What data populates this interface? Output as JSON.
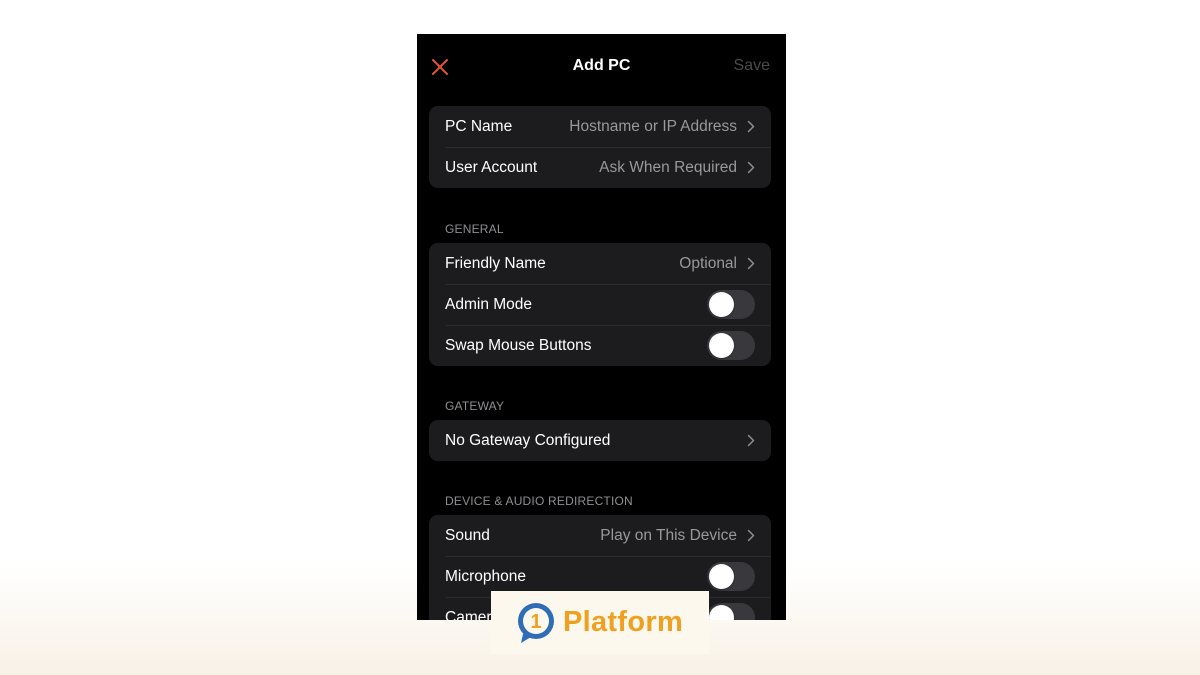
{
  "nav": {
    "close_icon": "close-icon",
    "title": "Add PC",
    "save_label": "Save"
  },
  "connection": {
    "rows": [
      {
        "label": "PC Name",
        "value": "Hostname or IP Address"
      },
      {
        "label": "User Account",
        "value": "Ask When Required"
      }
    ]
  },
  "general": {
    "header": "GENERAL",
    "friendly_name": {
      "label": "Friendly Name",
      "value": "Optional"
    },
    "admin_mode": {
      "label": "Admin Mode",
      "on": false
    },
    "swap_mouse": {
      "label": "Swap Mouse Buttons",
      "on": false
    }
  },
  "gateway": {
    "header": "GATEWAY",
    "row": {
      "label": "No Gateway Configured"
    }
  },
  "device_audio": {
    "header": "DEVICE & AUDIO REDIRECTION",
    "sound": {
      "label": "Sound",
      "value": "Play on This Device"
    },
    "microphone": {
      "label": "Microphone",
      "on": false
    },
    "camera": {
      "label": "Camera",
      "on": false
    }
  },
  "watermark": {
    "digit": "1",
    "text": "Platform"
  },
  "colors": {
    "close_accent": "#e0533d",
    "brand_orange": "#f0a020",
    "brand_blue": "#2f6db5"
  }
}
